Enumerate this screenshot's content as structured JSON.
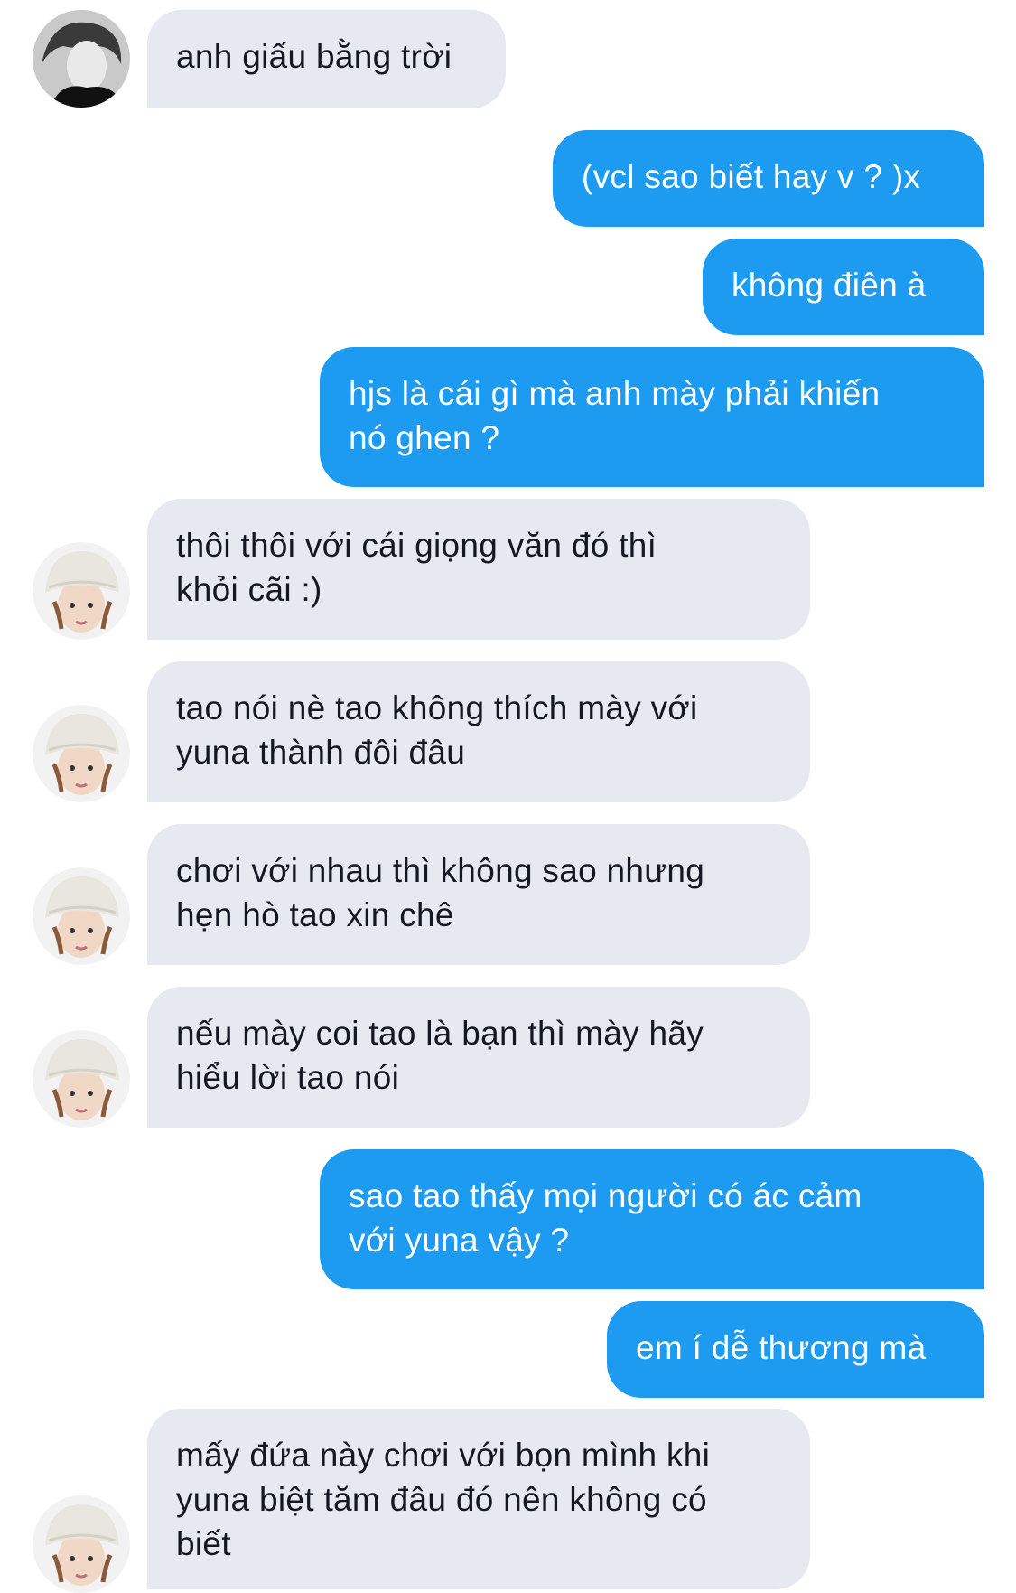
{
  "messages": [
    {
      "side": "in",
      "text": "anh giấu bằng trời",
      "avatar": "avatar-dark"
    },
    {
      "side": "out",
      "text": "(vcl sao biết hay v ? )x"
    },
    {
      "side": "out",
      "text": "không điên à"
    },
    {
      "side": "out",
      "text": "hjs là cái gì mà anh mày phải khiến\nnó ghen ?"
    },
    {
      "side": "in",
      "text": "thôi thôi với cái giọng văn đó thì\nkhỏi cãi :)",
      "avatar": "avatar-beanie"
    },
    {
      "side": "in",
      "text": "tao nói nè tao không thích mày với\nyuna thành đôi đâu",
      "avatar": "avatar-beanie"
    },
    {
      "side": "in",
      "text": "chơi với nhau thì không sao nhưng\nhẹn hò tao xin chê",
      "avatar": "avatar-beanie"
    },
    {
      "side": "in",
      "text": "nếu mày coi tao là bạn thì mày hãy\nhiểu lời tao nói",
      "avatar": "avatar-beanie"
    },
    {
      "side": "out",
      "text": "sao tao thấy mọi người có ác cảm\nvới yuna vậy ?"
    },
    {
      "side": "out",
      "text": "em í dễ thương mà"
    },
    {
      "side": "in",
      "text": "mấy đứa này chơi với bọn mình khi\nyuna biệt tăm đâu đó nên không có\nbiết",
      "avatar": "avatar-beanie"
    }
  ]
}
